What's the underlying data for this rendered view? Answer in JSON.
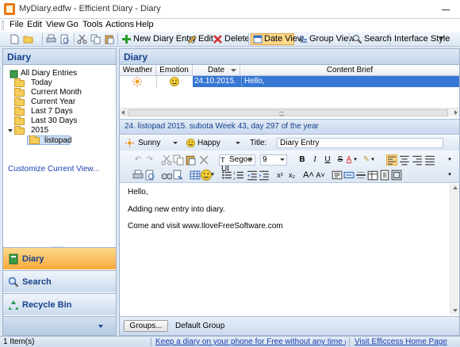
{
  "window": {
    "title": "MyDiary.edfw - Efficient Diary - Diary"
  },
  "menu": [
    "File",
    "Edit",
    "View",
    "Go",
    "Tools",
    "Actions",
    "Help"
  ],
  "toolbar": {
    "new_entry": "New Diary Entry",
    "edit": "Edit",
    "delete": "Delete",
    "date_view": "Date View",
    "group_view": "Group View",
    "search": "Search",
    "interface_style": "Interface Style"
  },
  "sidebar": {
    "header": "Diary",
    "tree": [
      "All Diary Entries",
      "Today",
      "Current Month",
      "Current Year",
      "Last 7 Days",
      "Last 30 Days",
      "2015",
      "listopad"
    ],
    "customize": "Customize Current View...",
    "nav": [
      "Diary",
      "Search",
      "Recycle Bin"
    ]
  },
  "main": {
    "header": "Diary",
    "columns": [
      "Weather",
      "Emotion",
      "Date",
      "Content Brief"
    ],
    "row": {
      "date": "24.10.2015.",
      "brief": "Hello,"
    },
    "date_bar": "24. listopad 2015. subota   Week 43, day 297 of the year",
    "weather": "Sunny",
    "emotion": "Happy",
    "title_label": "Title:",
    "title_value": "Diary Entry",
    "font": "Segoe UI",
    "font_size": "9",
    "body": [
      "Hello,",
      "Adding new entry into diary.",
      "Come and visit www.IloveFreeSoftware.com"
    ],
    "groups_button": "Groups...",
    "group_value": "Default Group"
  },
  "status": {
    "items": "1 Item(s)",
    "promo": "Keep a diary on your phone for Free without any time and place",
    "home": "Visit Efficcess Home Page"
  },
  "colors": {
    "accent": "#3778d4",
    "nav_active": "#f7a93a",
    "header_text": "#15418a"
  }
}
